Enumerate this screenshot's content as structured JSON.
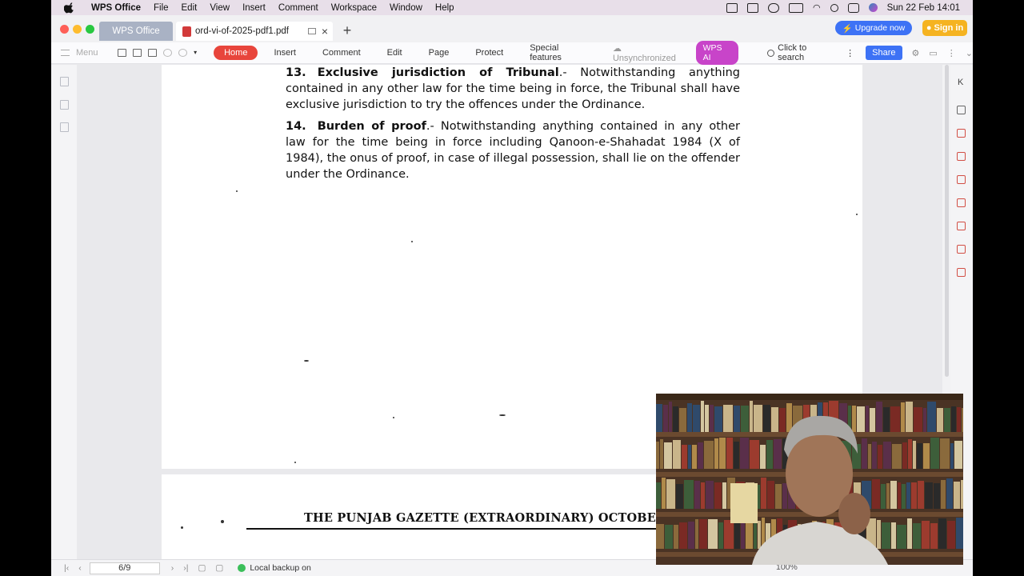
{
  "menubar": {
    "app_name": "WPS Office",
    "items": [
      "File",
      "Edit",
      "View",
      "Insert",
      "Comment",
      "Workspace",
      "Window",
      "Help"
    ],
    "datetime": "Sun 22 Feb  14:01"
  },
  "tabs": {
    "home_tab": "WPS Office",
    "doc_tab": "ord-vi-of-2025-pdf1.pdf",
    "upgrade": "Upgrade now",
    "signin": "Sign in"
  },
  "ribbon": {
    "menu": "Menu",
    "home": "Home",
    "items": [
      "Insert",
      "Comment",
      "Edit",
      "Page",
      "Protect",
      "Special features"
    ],
    "unsync": "Unsynchronized",
    "wpsai": "WPS AI",
    "search": "Click to search",
    "share": "Share"
  },
  "document": {
    "sec13_num": "13.",
    "sec13_title": "Exclusive jurisdiction of Tribunal",
    "sec13_text": ".- Notwithstanding anything contained in any other law for the time being in force, the Tribunal shall have exclusive jurisdiction to try the offences under the Ordinance.",
    "sec14_num": "14.",
    "sec14_title": "Burden of proof",
    "sec14_text": ".- Notwithstanding anything contained in any other law for the time being in force including Qanoon-e-Shahadat 1984 (X of 1984), the onus of proof, in case of illegal possession, shall lie on the offender under the Ordinance.",
    "gazette_header": "THE PUNJAB GAZETTE (EXTRAORDINARY)  OCTOBE"
  },
  "status": {
    "page": "6/9",
    "backup": "Local backup on",
    "zoom": "100%"
  },
  "colors": {
    "home_accent": "#e8453c",
    "wpsai": "#c844c9",
    "upgrade": "#3d72f5",
    "signin": "#f5b321"
  }
}
